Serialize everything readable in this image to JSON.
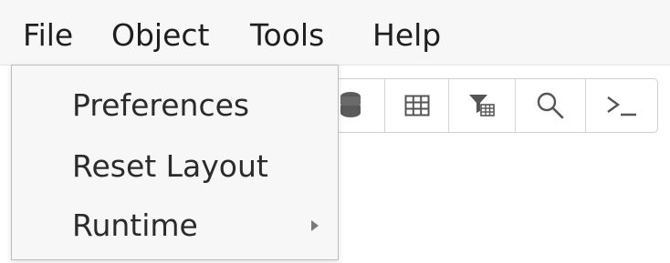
{
  "menubar": {
    "items": [
      {
        "label": "File"
      },
      {
        "label": "Object"
      },
      {
        "label": "Tools"
      },
      {
        "label": "Help"
      }
    ]
  },
  "file_menu": {
    "items": [
      {
        "label": "Preferences",
        "has_submenu": false
      },
      {
        "label": "Reset Layout",
        "has_submenu": false
      },
      {
        "label": "Runtime",
        "has_submenu": true
      }
    ]
  },
  "toolbar": {
    "icons": [
      "database-icon",
      "table-grid-icon",
      "filter-table-icon",
      "search-icon",
      "terminal-icon"
    ]
  },
  "colors": {
    "menubar_bg": "#f7f7f7",
    "menu_text": "#1e1e1e",
    "icon_color": "#555555",
    "border": "#cfcfcf"
  }
}
